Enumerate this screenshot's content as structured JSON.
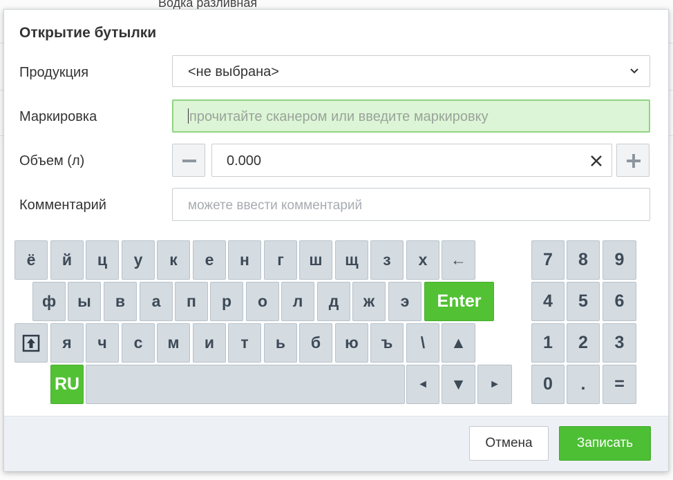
{
  "background": {
    "row_text": "Водка разливная"
  },
  "dialog": {
    "title": "Открытие бутылки",
    "product": {
      "label": "Продукция",
      "value": "<не выбрана>"
    },
    "marking": {
      "label": "Маркировка",
      "placeholder": "прочитайте сканером или введите маркировку"
    },
    "volume": {
      "label": "Объем (л)",
      "value": "0.000"
    },
    "comment": {
      "label": "Комментарий",
      "placeholder": "можете ввести комментарий"
    }
  },
  "keyboard": {
    "row1": [
      "ё",
      "й",
      "ц",
      "у",
      "к",
      "е",
      "н",
      "г",
      "ш",
      "щ",
      "з",
      "х",
      "←"
    ],
    "row2": [
      "ф",
      "ы",
      "в",
      "а",
      "п",
      "р",
      "о",
      "л",
      "д",
      "ж",
      "э"
    ],
    "enter": "Enter",
    "row3": [
      "я",
      "ч",
      "с",
      "м",
      "и",
      "т",
      "ь",
      "б",
      "ю",
      "ъ",
      "\\"
    ],
    "up": "▲",
    "lang": "RU",
    "left": "◄",
    "down": "▼",
    "right": "►",
    "numpad": [
      "7",
      "8",
      "9",
      "4",
      "5",
      "6",
      "1",
      "2",
      "3",
      "0",
      ".",
      "="
    ]
  },
  "footer": {
    "cancel": "Отмена",
    "save": "Записать"
  },
  "colors": {
    "accent_green": "#4cbf34",
    "key_bg": "#d4dbe1",
    "marking_bg": "#dcf5d6"
  },
  "icons": {
    "chevron": "chevron-down-icon",
    "minus": "minus-icon",
    "plus": "plus-icon",
    "clear": "clear-x-icon",
    "shift": "shift-up-icon"
  }
}
